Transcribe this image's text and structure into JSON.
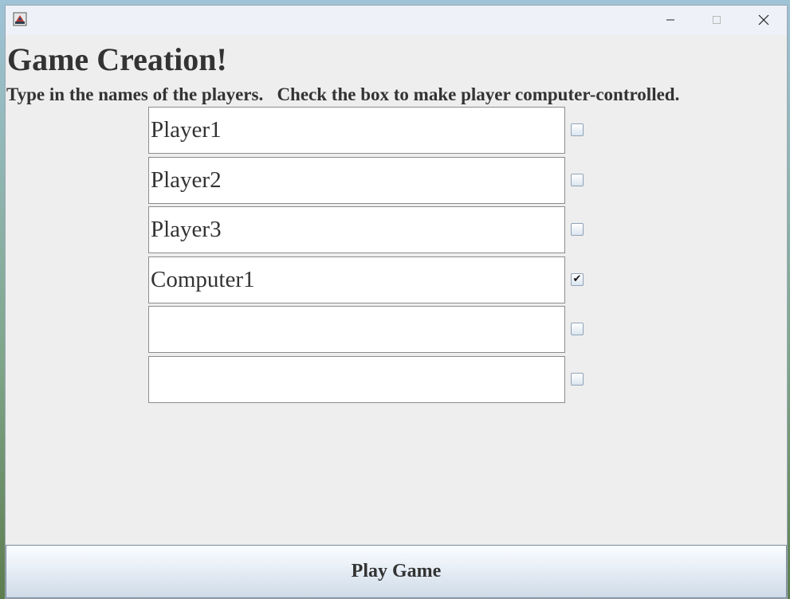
{
  "window": {
    "title": "",
    "app_icon": "java-app-icon",
    "controls": {
      "minimize_icon": "minimize-icon",
      "maximize_icon": "maximize-icon",
      "close_icon": "close-icon"
    }
  },
  "heading": "Game Creation!",
  "instructions": "Type in the names of the players.   Check the box to make player computer-controlled.",
  "players": [
    {
      "name": "Player1",
      "computer": false
    },
    {
      "name": "Player2",
      "computer": false
    },
    {
      "name": "Player3",
      "computer": false
    },
    {
      "name": "Computer1",
      "computer": true
    },
    {
      "name": "",
      "computer": false
    },
    {
      "name": "",
      "computer": false
    }
  ],
  "checkmark_glyph": "✔",
  "play_button_label": "Play Game",
  "colors": {
    "window_bg": "#eeeeee",
    "text": "#333333",
    "titlebar": "#eef2f8"
  }
}
